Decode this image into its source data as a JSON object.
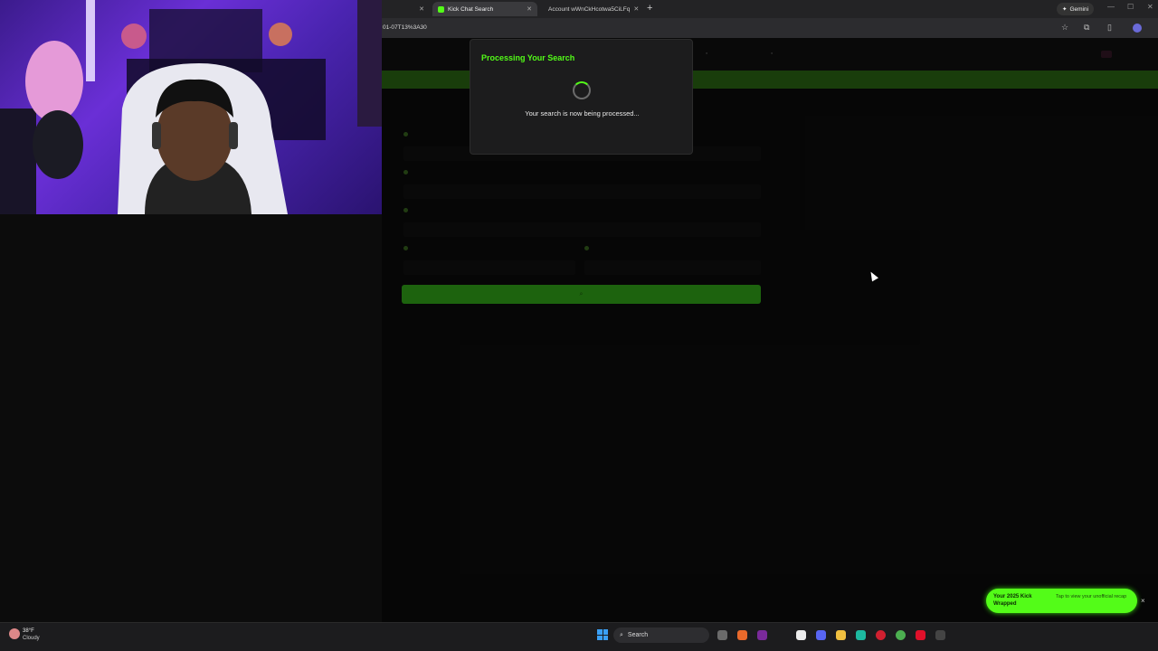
{
  "browser": {
    "tabs": [
      {
        "label": "Kick Chat Search",
        "active": true
      },
      {
        "label": "Account wWnCkHcotwa5CiLFq",
        "active": false
      }
    ],
    "gemini_label": "Gemini",
    "url": "01-07T13%3A30"
  },
  "modal": {
    "title": "Processing Your Search",
    "message": "Your search is now being processed..."
  },
  "toast": {
    "title": "Your 2025 Kick Wrapped",
    "message": "Tap to view your unofficial recap",
    "close": "×"
  },
  "taskbar": {
    "temperature": "38°F",
    "condition": "Cloudy",
    "search_placeholder": "Search"
  },
  "colors": {
    "accent": "#53fc18",
    "search_button": "#35b51a"
  }
}
